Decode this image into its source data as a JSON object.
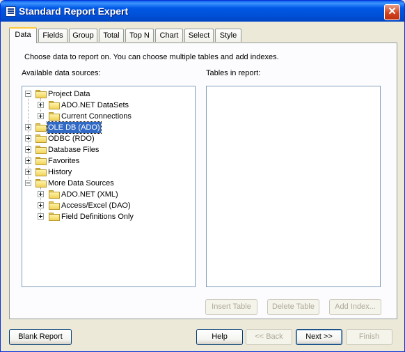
{
  "window": {
    "title": "Standard Report Expert",
    "close_glyph": "✕"
  },
  "tabs": [
    "Data",
    "Fields",
    "Group",
    "Total",
    "Top N",
    "Chart",
    "Select",
    "Style"
  ],
  "active_tab": "Data",
  "panel": {
    "instruction": "Choose data to report on. You can choose multiple tables and add indexes.",
    "available_label": "Available data sources:",
    "tables_label": "Tables in report:"
  },
  "tree": {
    "items": [
      {
        "label": "Project Data",
        "expanded": true,
        "icon": "folder-icon"
      },
      {
        "label": "ADO.NET DataSets",
        "expanded": false,
        "icon": "folder-icon"
      },
      {
        "label": "Current Connections",
        "expanded": false,
        "icon": "folder-icon"
      },
      {
        "label": "OLE DB (ADO)",
        "expanded": false,
        "selected": true,
        "icon": "folder-icon"
      },
      {
        "label": "ODBC (RDO)",
        "expanded": false,
        "icon": "folder-icon"
      },
      {
        "label": "Database Files",
        "expanded": false,
        "icon": "folder-icon"
      },
      {
        "label": "Favorites",
        "expanded": false,
        "icon": "folder-icon"
      },
      {
        "label": "History",
        "expanded": false,
        "icon": "folder-icon"
      },
      {
        "label": "More Data Sources",
        "expanded": true,
        "icon": "folder-icon"
      },
      {
        "label": "ADO.NET (XML)",
        "expanded": false,
        "icon": "folder-icon"
      },
      {
        "label": "Access/Excel (DAO)",
        "expanded": false,
        "icon": "folder-icon"
      },
      {
        "label": "Field Definitions Only",
        "expanded": false,
        "icon": "folder-icon"
      }
    ]
  },
  "panel_buttons": {
    "insert_table": "Insert Table",
    "delete_table": "Delete Table",
    "add_index": "Add Index..."
  },
  "footer_buttons": {
    "blank_report": "Blank Report",
    "help": "Help",
    "back": "<< Back",
    "next": "Next >>",
    "finish": "Finish"
  }
}
